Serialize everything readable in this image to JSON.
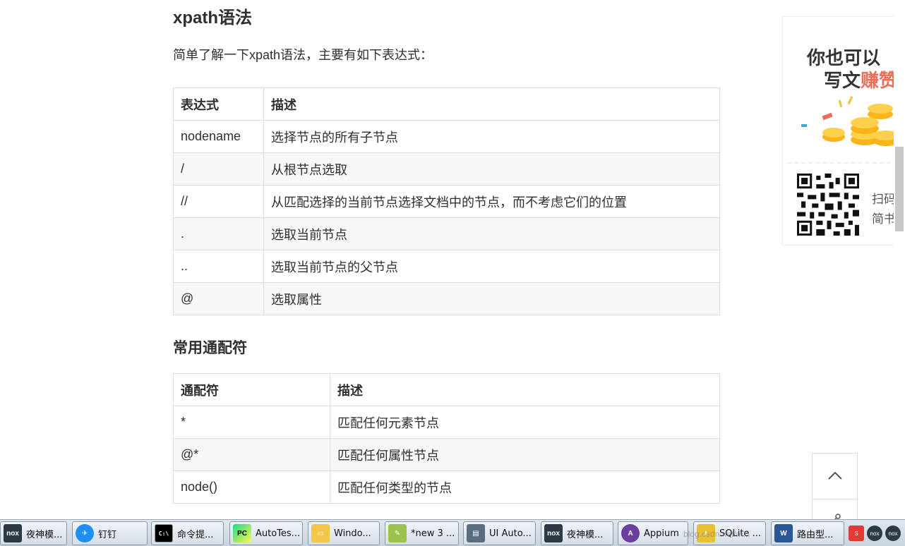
{
  "article": {
    "heading": "xpath语法",
    "intro": "简单了解一下xpath语法，主要有如下表达式：",
    "expressions_table": {
      "headers": [
        "表达式",
        "描述"
      ],
      "rows": [
        [
          "nodename",
          "选择节点的所有子节点"
        ],
        [
          "/",
          "从根节点选取"
        ],
        [
          "//",
          "从匹配选择的当前节点选择文档中的节点，而不考虑它们的位置"
        ],
        [
          ".",
          "选取当前节点"
        ],
        [
          "..",
          "选取当前节点的父节点"
        ],
        [
          "@",
          "选取属性"
        ]
      ]
    },
    "wildcard_heading": "常用通配符",
    "wildcard_table": {
      "headers": [
        "通配符",
        "描述"
      ],
      "rows": [
        [
          "*",
          "匹配任何元素节点"
        ],
        [
          "@*",
          "匹配任何属性节点"
        ],
        [
          "node()",
          "匹配任何类型的节点"
        ]
      ]
    }
  },
  "side_ad": {
    "line1": "你也可以",
    "line2_prefix": "写文",
    "line2_accent": "赚赞",
    "caption1": "扫码",
    "caption2": "简书",
    "accent_color": "#ea6f5a"
  },
  "taskbar": {
    "items": [
      {
        "label": "夜神模...",
        "icon": "nox-icon"
      },
      {
        "label": "钉钉",
        "icon": "dingtalk-icon"
      },
      {
        "label": "命令提...",
        "icon": "cmd-icon"
      },
      {
        "label": "AutoTes...",
        "icon": "pycharm-icon"
      },
      {
        "label": "Windo...",
        "icon": "explorer-icon"
      },
      {
        "label": "*new 3 ...",
        "icon": "notepad-icon"
      },
      {
        "label": "UI Auto...",
        "icon": "uiautomator-icon"
      },
      {
        "label": "夜神模...",
        "icon": "nox-icon"
      },
      {
        "label": "Appium",
        "icon": "appium-icon"
      },
      {
        "label": "SQLite ...",
        "icon": "sqlite-icon"
      },
      {
        "label": "路由型...",
        "icon": "word-icon"
      }
    ],
    "watermark": "blog.csdn.net/m..."
  }
}
